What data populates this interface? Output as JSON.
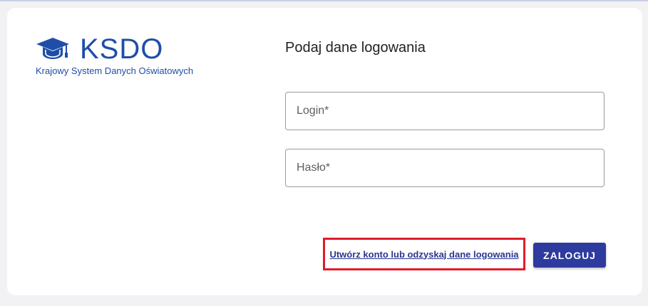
{
  "brand": {
    "name": "KSDO",
    "subtitle": "Krajowy System Danych Oświatowych",
    "icon": "graduation-cap-icon",
    "color": "#1f4ea8"
  },
  "form": {
    "title": "Podaj dane logowania",
    "login_placeholder": "Login*",
    "password_placeholder": "Hasło*",
    "login_value": "",
    "password_value": ""
  },
  "actions": {
    "register_link": "Utwórz konto lub odzyskaj dane logowania",
    "login_button": "ZALOGUJ",
    "button_color": "#2e3b9e",
    "highlight_color": "#e01b2a"
  }
}
